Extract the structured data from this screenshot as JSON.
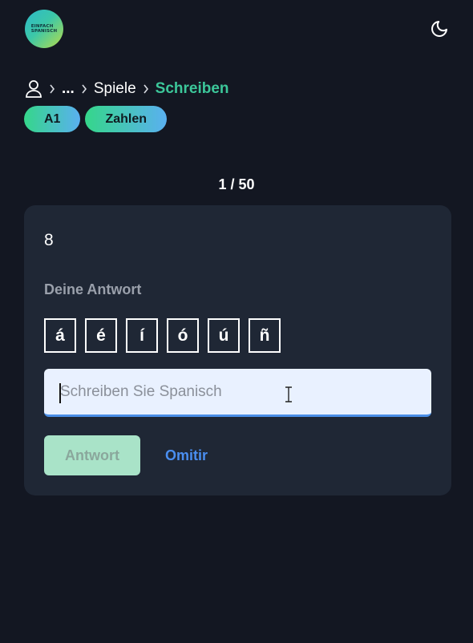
{
  "header": {
    "logo_line1": "EINFACH",
    "logo_line2": "SPANISCH",
    "theme_icon": "moon-icon"
  },
  "breadcrumb": {
    "home_icon": "user-icon",
    "ellipsis": "...",
    "games": "Spiele",
    "current": "Schreiben"
  },
  "tags": [
    {
      "label": "A1"
    },
    {
      "label": "Zahlen"
    }
  ],
  "progress": {
    "text": "1 / 50",
    "current": 1,
    "total": 50
  },
  "card": {
    "prompt": "8",
    "answer_label": "Deine Antwort",
    "accents": [
      "á",
      "é",
      "í",
      "ó",
      "ú",
      "ñ"
    ],
    "input": {
      "value": "",
      "placeholder": "Schreiben Sie Spanisch"
    },
    "submit_label": "Antwort",
    "skip_label": "Omitir"
  },
  "colors": {
    "background": "#131722",
    "card": "#1f2735",
    "accent_green": "#3cc79a",
    "accent_blue": "#4a8ef0"
  }
}
